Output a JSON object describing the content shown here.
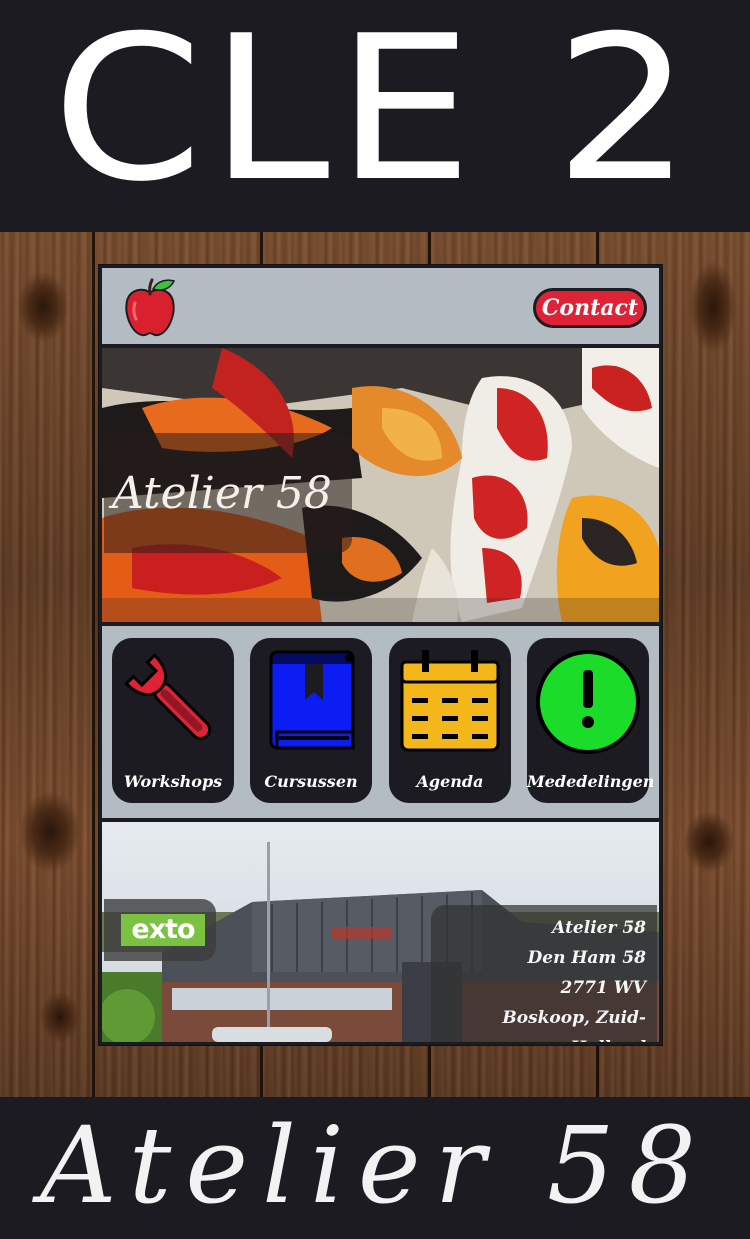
{
  "header_banner": {
    "title": "CLE 2"
  },
  "nav": {
    "logo_icon": "apple-icon",
    "contact_label": "Contact"
  },
  "hero": {
    "title": "Atelier 58"
  },
  "menu": {
    "tiles": [
      {
        "label": "Workshops",
        "icon": "wrench-icon",
        "color": "#e02236"
      },
      {
        "label": "Cursussen",
        "icon": "book-icon",
        "color": "#0b1df2"
      },
      {
        "label": "Agenda",
        "icon": "calendar-icon",
        "color": "#f4b71a"
      },
      {
        "label": "Mededelingen",
        "icon": "exclamation-icon",
        "color": "#1bdc29"
      }
    ]
  },
  "location": {
    "partner_logo": "exto",
    "address": {
      "name": "Atelier 58",
      "street": "Den Ham 58",
      "postcode": "2771 WV",
      "city": "Boskoop, Zuid-Holland"
    }
  },
  "footer_banner": {
    "title": "Atelier 58"
  },
  "colors": {
    "dark": "#1c1b22",
    "nav_bg": "#b3bcc3",
    "accent_red": "#e02236",
    "wood": "#6b4228"
  }
}
